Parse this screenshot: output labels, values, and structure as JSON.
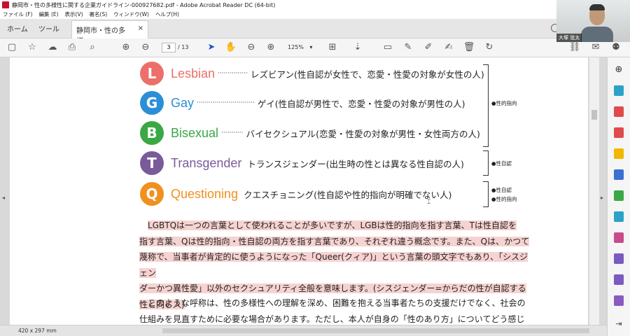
{
  "window": {
    "title": "静岡市・性の多様性に関する企業ガイドライン-000927682.pdf - Adobe Acrobat Reader DC (64-bit)"
  },
  "menu": [
    "ファイル (F)",
    "編集 (E)",
    "表示(V)",
    "署名(S)",
    "ウィンドウ(W)",
    "ヘルプ(H)"
  ],
  "tabs": {
    "home": "ホーム",
    "tools": "ツール",
    "doc": "静岡市・性の多様...",
    "close": "×"
  },
  "toolbar": {
    "page_current": "3",
    "page_total": "/ 13",
    "zoom": "125%"
  },
  "webcam": {
    "name": "大塚 弦太"
  },
  "status": {
    "page_size": "420 x 297 mm"
  },
  "colors": {
    "L": "#ec6f6a",
    "G": "#2b8fd7",
    "B": "#3aa845",
    "T": "#7a5b9a",
    "Q": "#f0901e",
    "highlight": "#f6d3d0"
  },
  "lgbtq": [
    {
      "letter": "L",
      "term": "Lesbian",
      "dots": "···············",
      "desc": "レズビアン(性自認が女性で、恋愛・性愛の対象が女性の人)"
    },
    {
      "letter": "G",
      "term": "Gay",
      "dots": "·····························",
      "desc": "ゲイ(性自認が男性で、恋愛・性愛の対象が男性の人)"
    },
    {
      "letter": "B",
      "term": "Bisexual",
      "dots": "···········",
      "desc": "バイセクシュアル(恋愛・性愛の対象が男性・女性両方の人)"
    },
    {
      "letter": "T",
      "term": "Transgender",
      "dots": "",
      "desc": "トランスジェンダー(出生時の性とは異なる性自認の人)"
    },
    {
      "letter": "Q",
      "term": "Questioning",
      "dots": "",
      "desc": "クエスチョニング(性自認や性的指向が明確でない人)"
    }
  ],
  "side_labels": {
    "orientation": "●性的指向",
    "identity": "●性自認",
    "q_identity": "●性自認",
    "q_orientation": "●性的指向"
  },
  "paragraph1": [
    "LGBTQは一つの言葉として使われることが多いですが、LGBは性的指向を指す言葉、Tは性自認を",
    "指す言葉、Qは性的指向・性自認の両方を指す言葉であり、それぞれ違う概念です。また、Qは、かつて",
    "蔑称で、当事者が肯定的に使うようになった「Queer(クィア)」という言葉の頭文字でもあり、「シスジェン",
    "ダーかつ異性愛」以外のセクシュアリティ全般を意味します。(シスジェンダー=からだの性が自認する",
    "性と同じ人)"
  ],
  "paragraph2": [
    "このような呼称は、性の多様性への理解を深め、困難を抱える当事者たちの支援だけでなく、社会の",
    "仕組みを見直すために必要な場合があります。ただし、本人が自身の「性のあり方」についてどう感じて"
  ]
}
